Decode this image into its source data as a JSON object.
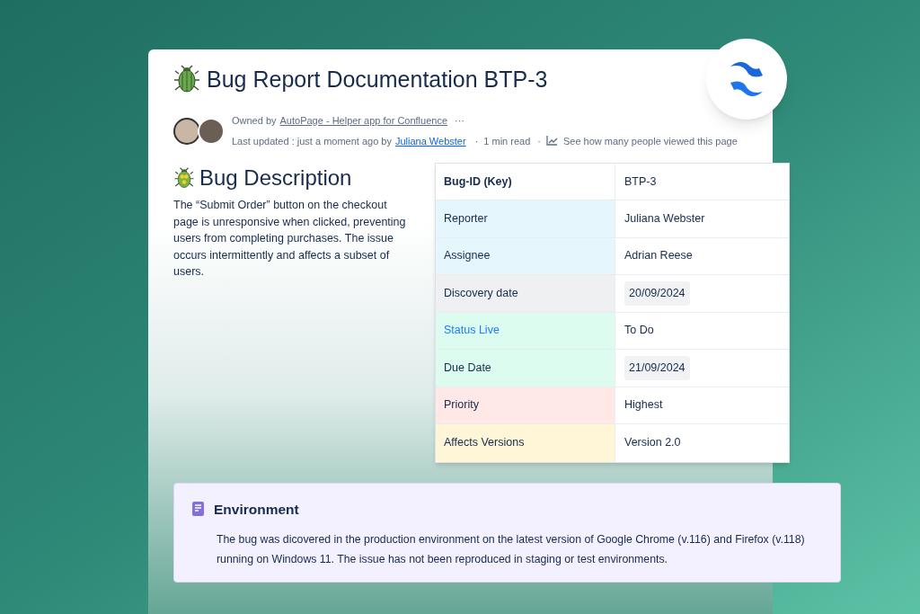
{
  "page": {
    "title": "Bug Report Documentation BTP-3",
    "owner_prefix": "Owned by",
    "owner_link": "AutoPage - Helper app for Confluence",
    "more": "···",
    "updated_prefix": "Last updated : just a moment ago by",
    "updated_by": "Juliana Webster",
    "separator": "·",
    "read_time": "1 min read",
    "views_link": "See how many people viewed this page"
  },
  "description": {
    "heading": "Bug Description",
    "text": "The “Submit Order” button on the checkout page is unresponsive when clicked, preventing users from completing purchases. The issue occurs intermittently and affects a subset of users."
  },
  "table": {
    "header": {
      "label": "Bug-ID (Key)",
      "value": "BTP-3"
    },
    "rows": [
      {
        "label": "Reporter",
        "value": "Juliana Webster",
        "kind": "text",
        "link": false,
        "color": "#e6f6fd"
      },
      {
        "label": "Assignee",
        "value": "Adrian Reese",
        "kind": "text",
        "link": false,
        "color": "#e6f6fd"
      },
      {
        "label": "Discovery date",
        "value": "20/09/2024",
        "kind": "date",
        "link": false,
        "color": "#eef0f2"
      },
      {
        "label": "Status Live",
        "value": "To Do",
        "kind": "text",
        "link": true,
        "color": "#dcfcef"
      },
      {
        "label": "Due Date",
        "value": "21/09/2024",
        "kind": "date",
        "link": false,
        "color": "#dcfcef"
      },
      {
        "label": "Priority",
        "value": "Highest",
        "kind": "text",
        "link": false,
        "color": "#ffe8e6"
      },
      {
        "label": "Affects Versions",
        "value": "Version 2.0",
        "kind": "text",
        "link": false,
        "color": "#fff6d8"
      }
    ]
  },
  "environment": {
    "title": "Environment",
    "text": "The bug was dicovered in the production environment on the latest version of Google Chrome (v.116) and Firefox (v.118) running on Windows 11. The issue has not been reproduced in staging or test environments."
  }
}
